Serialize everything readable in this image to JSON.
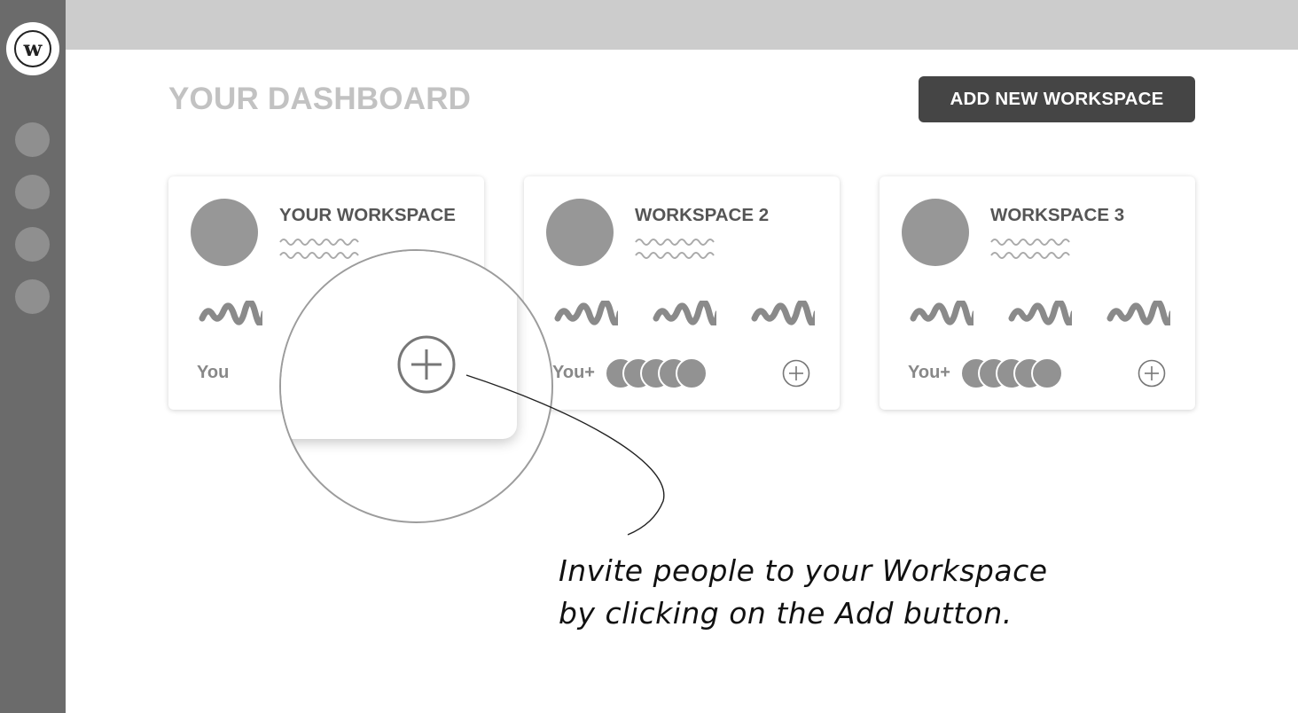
{
  "sidebar": {
    "logo_letter": "w",
    "nav_items": [
      {
        "icon": "nav-dot-icon"
      },
      {
        "icon": "nav-dot-icon"
      },
      {
        "icon": "nav-dot-icon"
      },
      {
        "icon": "nav-dot-icon"
      }
    ]
  },
  "header": {
    "title": "YOUR DASHBOARD",
    "add_button_label": "ADD NEW WORKSPACE"
  },
  "workspaces": [
    {
      "title": "YOUR WORKSPACE",
      "owner_label": "You",
      "member_count": 0,
      "add_icon": "plus-circle-icon"
    },
    {
      "title": "WORKSPACE 2",
      "owner_label": "You+",
      "member_count": 5,
      "add_icon": "plus-circle-icon"
    },
    {
      "title": "WORKSPACE 3",
      "owner_label": "You+",
      "member_count": 5,
      "add_icon": "plus-circle-icon"
    }
  ],
  "callout": {
    "line1": "Invite people to your Workspace",
    "line2": "by clicking on the Add button."
  },
  "colors": {
    "sidebar": "#6b6b6b",
    "topbar": "#cccccc",
    "button": "#454545",
    "placeholder": "#979797",
    "title_muted": "#c2c2c2"
  }
}
